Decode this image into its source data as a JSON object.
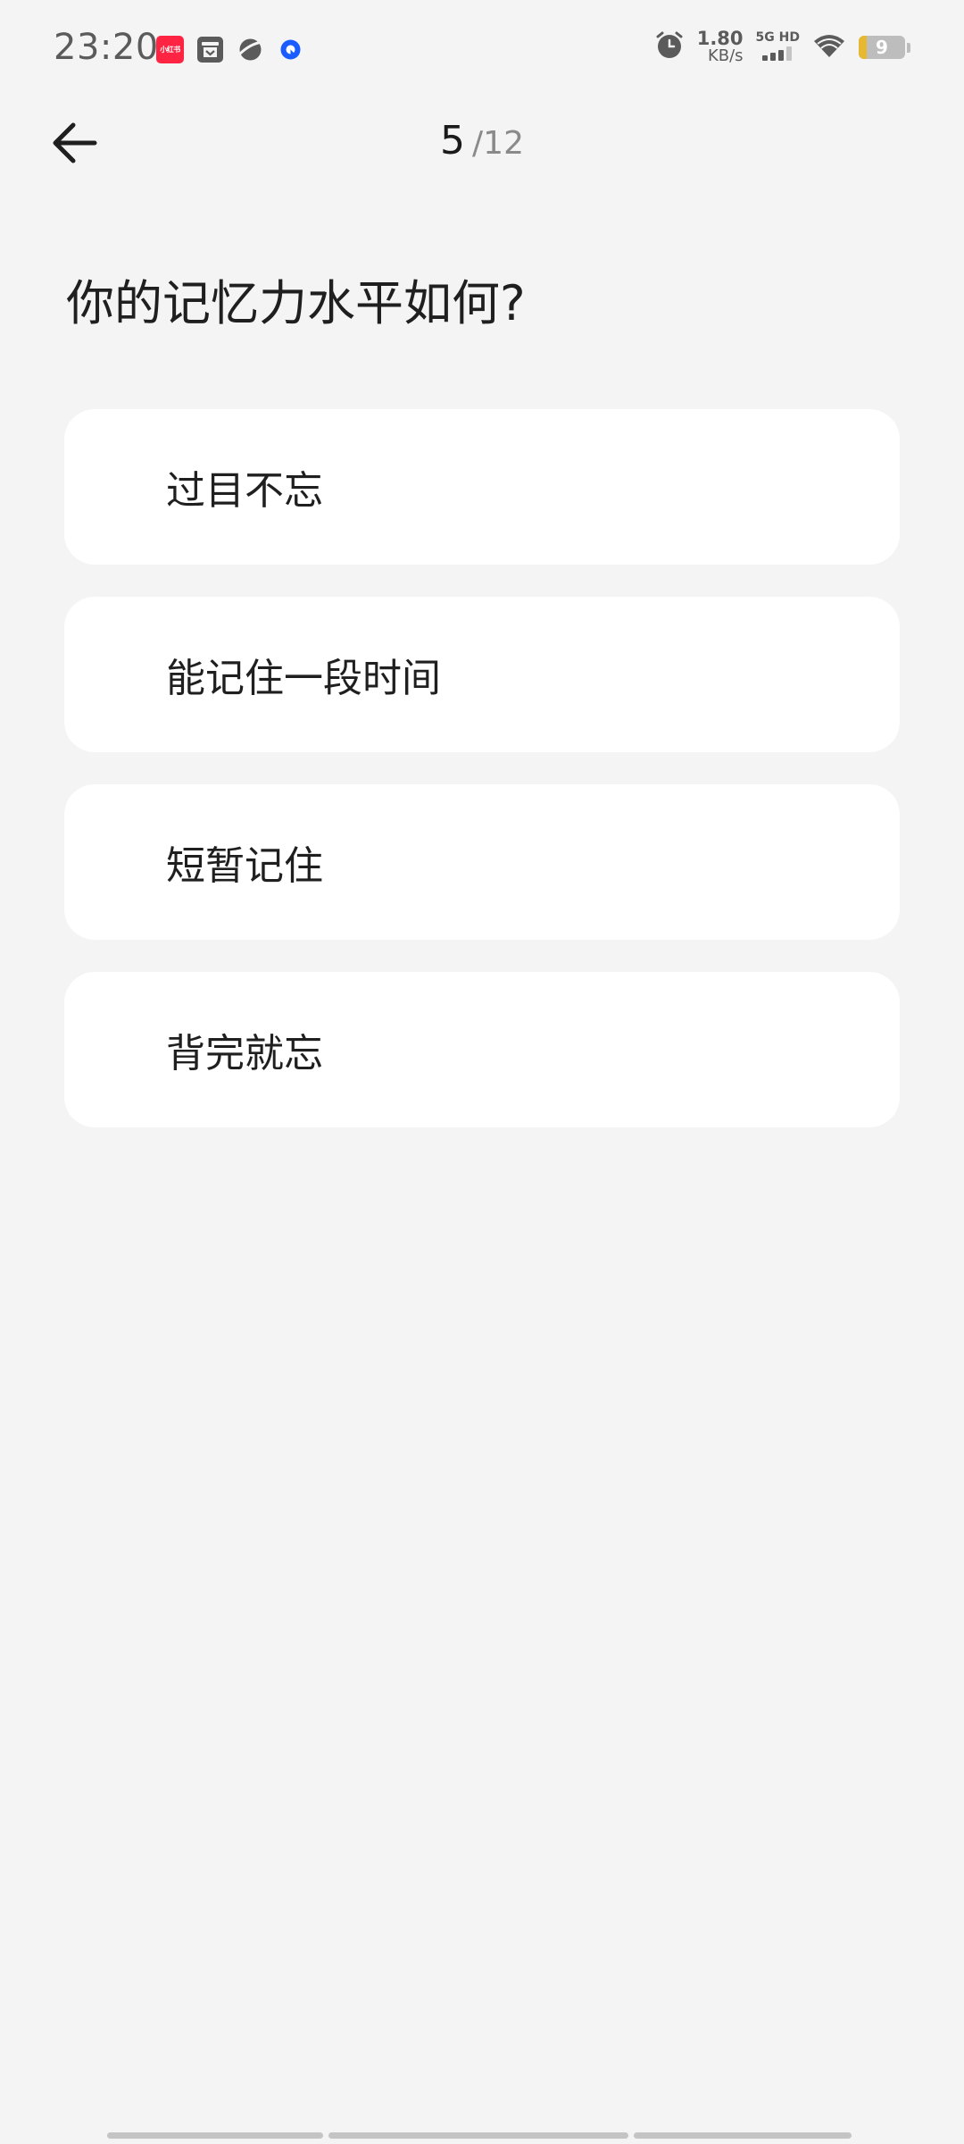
{
  "status_bar": {
    "time": "23:20",
    "redbook_icon_text": "小红书",
    "net_speed_value": "1.80",
    "net_speed_unit": "KB/s",
    "network_label": "5G HD",
    "battery_level": "9",
    "battery_fraction": 0.09,
    "battery_fill_color": "#e7b932",
    "icons": [
      "redbook-app-icon",
      "archive-app-icon",
      "planet-app-icon",
      "blue-dot-app-icon",
      "alarm-icon",
      "signal-icon",
      "wifi-icon",
      "battery-icon"
    ]
  },
  "header": {
    "back_icon": "back-arrow-icon",
    "progress_current": "5",
    "progress_total": "/12"
  },
  "question": "你的记忆力水平如何?",
  "options": [
    {
      "label": "过目不忘"
    },
    {
      "label": "能记住一段时间"
    },
    {
      "label": "短暂记住"
    },
    {
      "label": "背完就忘"
    }
  ],
  "colors": {
    "background": "#f4f4f4",
    "card": "#ffffff",
    "text_primary": "#1f1f1f",
    "text_secondary": "#8a8a8a"
  }
}
